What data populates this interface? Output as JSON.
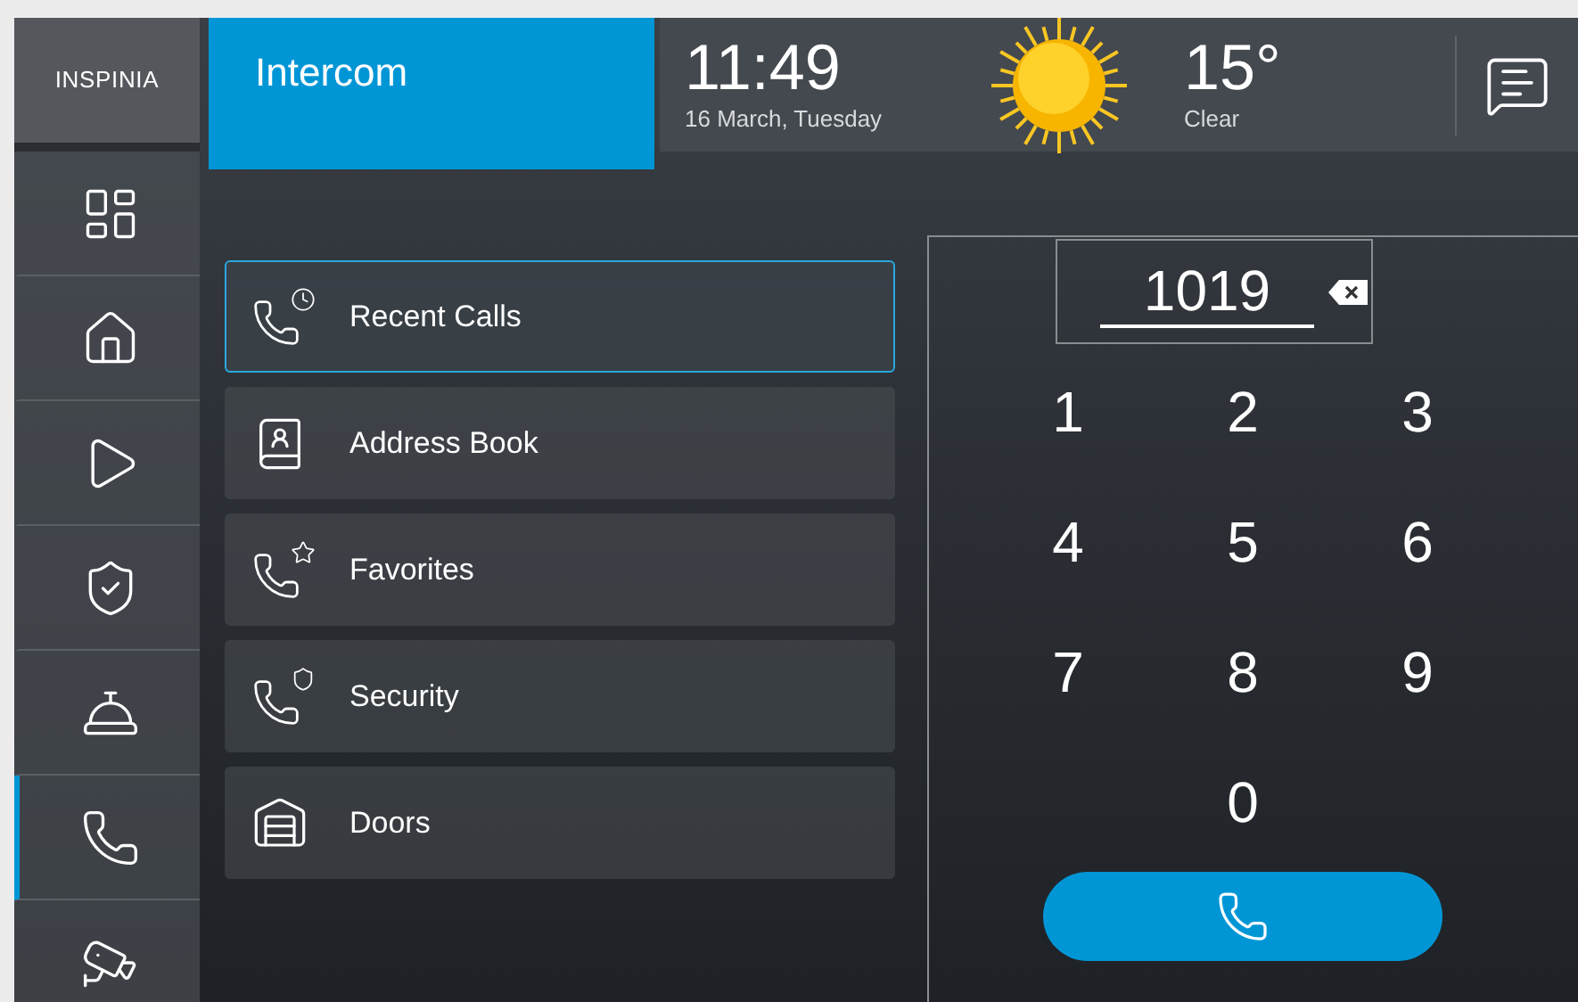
{
  "logo": "INSPINIA",
  "title": "Intercom",
  "clock": {
    "time": "11:49",
    "date": "16 March, Tuesday"
  },
  "weather": {
    "temperature": "15°",
    "condition": "Clear"
  },
  "nav": [
    {
      "kind": "dashboard",
      "selected": false
    },
    {
      "kind": "home",
      "selected": false
    },
    {
      "kind": "media",
      "selected": false
    },
    {
      "kind": "security",
      "selected": false
    },
    {
      "kind": "service",
      "selected": false
    },
    {
      "kind": "intercom",
      "selected": true
    },
    {
      "kind": "camera",
      "selected": false
    }
  ],
  "menu": [
    {
      "label": "Recent Calls",
      "kind": "recent",
      "selected": true
    },
    {
      "label": "Address Book",
      "kind": "book",
      "selected": false
    },
    {
      "label": "Favorites",
      "kind": "favorites",
      "selected": false
    },
    {
      "label": "Security",
      "kind": "security",
      "selected": false
    },
    {
      "label": "Doors",
      "kind": "doors",
      "selected": false
    }
  ],
  "dialer": {
    "value": "1019",
    "keys": [
      "1",
      "2",
      "3",
      "4",
      "5",
      "6",
      "7",
      "8",
      "9",
      "0"
    ]
  }
}
